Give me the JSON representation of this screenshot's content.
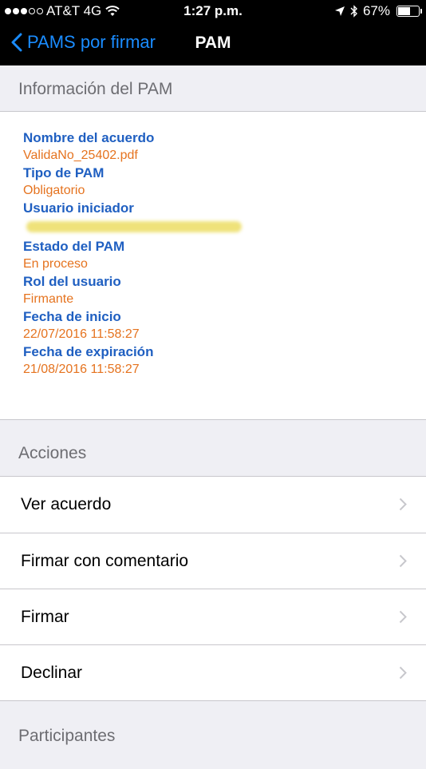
{
  "status_bar": {
    "carrier": "AT&T 4G",
    "time": "1:27 p.m.",
    "battery": "67%",
    "battery_level": 0.67,
    "signal_bars": 3
  },
  "nav": {
    "back_label": "PAMS por firmar",
    "title": "PAM"
  },
  "info_section": {
    "header": "Información del PAM",
    "fields": [
      {
        "label": "Nombre del acuerdo",
        "value": "ValidaNo_25402.pdf"
      },
      {
        "label": "Tipo de PAM",
        "value": "Obligatorio"
      },
      {
        "label": "Usuario iniciador",
        "value": ""
      },
      {
        "label": "Estado del PAM",
        "value": "En proceso"
      },
      {
        "label": "Rol del usuario",
        "value": "Firmante"
      },
      {
        "label": "Fecha de inicio",
        "value": "22/07/2016 11:58:27"
      },
      {
        "label": "Fecha de expiración",
        "value": "21/08/2016 11:58:27"
      }
    ]
  },
  "actions_section": {
    "header": "Acciones",
    "items": [
      {
        "label": "Ver acuerdo"
      },
      {
        "label": "Firmar con comentario"
      },
      {
        "label": "Firmar"
      },
      {
        "label": "Declinar"
      }
    ]
  },
  "participants_section": {
    "header": "Participantes"
  },
  "colors": {
    "accent": "#1a8cff",
    "label": "#1f5fc1",
    "value": "#e5731f"
  }
}
